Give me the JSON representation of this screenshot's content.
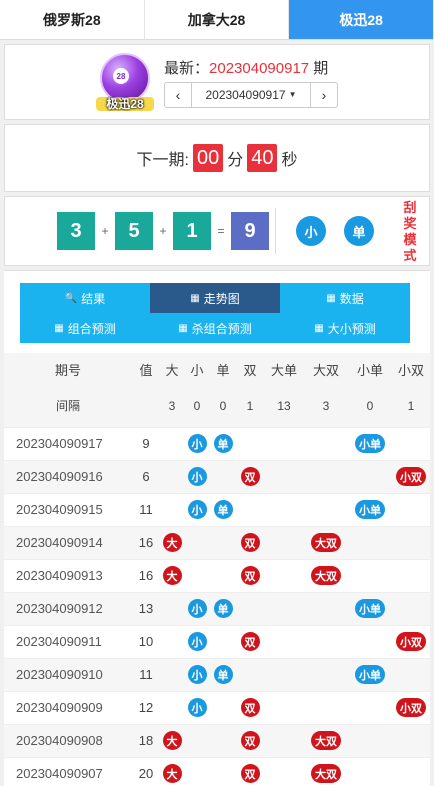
{
  "tabs": [
    {
      "label": "俄罗斯28"
    },
    {
      "label": "加拿大28"
    },
    {
      "label": "极迅28"
    }
  ],
  "logo": {
    "ball_number": "28",
    "ball_text": "极迅",
    "caption": "极迅28"
  },
  "latest": {
    "prefix": "最新：",
    "issue": "202304090917",
    "suffix": " 期",
    "selected_issue": "202304090917",
    "prev_icon": "chevron-left",
    "next_icon": "chevron-right"
  },
  "countdown": {
    "label": "下一期:",
    "minutes": "00",
    "min_unit": "分",
    "seconds": "40",
    "sec_unit": "秒"
  },
  "result": {
    "n1": "3",
    "op1": "+",
    "n2": "5",
    "op2": "+",
    "n3": "1",
    "eq": "=",
    "sum": "9",
    "size": "小",
    "parity": "单",
    "mode_chars": [
      "刮",
      "奖",
      "模",
      "式"
    ]
  },
  "menu": {
    "row1": [
      {
        "label": "结果",
        "icon": "search-icon"
      },
      {
        "label": "走势图",
        "icon": "chart-icon"
      },
      {
        "label": "数据",
        "icon": "chart-icon"
      }
    ],
    "row2": [
      {
        "label": "组合预测",
        "icon": "chart-icon"
      },
      {
        "label": "杀组合预测",
        "icon": "chart-icon"
      },
      {
        "label": "大小预测",
        "icon": "chart-icon"
      }
    ]
  },
  "table": {
    "headers": [
      "期号",
      "值",
      "大",
      "小",
      "单",
      "双",
      "大单",
      "大双",
      "小单",
      "小双"
    ],
    "gap_label": "间隔",
    "gaps": [
      "3",
      "0",
      "0",
      "1",
      "13",
      "3",
      "0",
      "1"
    ],
    "rows": [
      {
        "period": "202304090917",
        "value": "9",
        "big": "",
        "small": "小",
        "odd": "单",
        "even": "",
        "bo": "",
        "be": "",
        "so": "小单",
        "se": ""
      },
      {
        "period": "202304090916",
        "value": "6",
        "big": "",
        "small": "小",
        "odd": "",
        "even": "双",
        "bo": "",
        "be": "",
        "so": "",
        "se": "小双"
      },
      {
        "period": "202304090915",
        "value": "11",
        "big": "",
        "small": "小",
        "odd": "单",
        "even": "",
        "bo": "",
        "be": "",
        "so": "小单",
        "se": ""
      },
      {
        "period": "202304090914",
        "value": "16",
        "big": "大",
        "small": "",
        "odd": "",
        "even": "双",
        "bo": "",
        "be": "大双",
        "so": "",
        "se": ""
      },
      {
        "period": "202304090913",
        "value": "16",
        "big": "大",
        "small": "",
        "odd": "",
        "even": "双",
        "bo": "",
        "be": "大双",
        "so": "",
        "se": ""
      },
      {
        "period": "202304090912",
        "value": "13",
        "big": "",
        "small": "小",
        "odd": "单",
        "even": "",
        "bo": "",
        "be": "",
        "so": "小单",
        "se": ""
      },
      {
        "period": "202304090911",
        "value": "10",
        "big": "",
        "small": "小",
        "odd": "",
        "even": "双",
        "bo": "",
        "be": "",
        "so": "",
        "se": "小双"
      },
      {
        "period": "202304090910",
        "value": "11",
        "big": "",
        "small": "小",
        "odd": "单",
        "even": "",
        "bo": "",
        "be": "",
        "so": "小单",
        "se": ""
      },
      {
        "period": "202304090909",
        "value": "12",
        "big": "",
        "small": "小",
        "odd": "",
        "even": "双",
        "bo": "",
        "be": "",
        "so": "",
        "se": "小双"
      },
      {
        "period": "202304090908",
        "value": "18",
        "big": "大",
        "small": "",
        "odd": "",
        "even": "双",
        "bo": "",
        "be": "大双",
        "so": "",
        "se": ""
      },
      {
        "period": "202304090907",
        "value": "20",
        "big": "大",
        "small": "",
        "odd": "",
        "even": "双",
        "bo": "",
        "be": "大双",
        "so": "",
        "se": ""
      }
    ]
  },
  "colors": {
    "blue": "#1a98e0",
    "red": "#d0141c",
    "accent": "#3296f0",
    "teal": "#1aa89a"
  }
}
